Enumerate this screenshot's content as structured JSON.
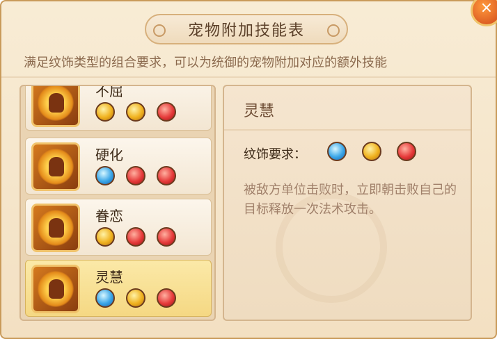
{
  "title": "宠物附加技能表",
  "close_icon": "×",
  "subtitle": "满足纹饰类型的组合要求，可以为统御的宠物附加对应的额外技能",
  "skills": [
    {
      "name": "不屈",
      "gems": [
        "gold",
        "gold",
        "red"
      ]
    },
    {
      "name": "硬化",
      "gems": [
        "blue",
        "red",
        "red"
      ]
    },
    {
      "name": "眷恋",
      "gems": [
        "gold",
        "red",
        "red"
      ]
    },
    {
      "name": "灵慧",
      "gems": [
        "blue",
        "gold",
        "red"
      ]
    }
  ],
  "detail": {
    "title": "灵慧",
    "req_label": "纹饰要求：",
    "gems": [
      "blue",
      "gold",
      "red"
    ],
    "description": "被敌方单位击败时，立即朝击败自己的目标释放一次法术攻击。"
  },
  "colors": {
    "gold": "#f0b21f",
    "red": "#e63b3b",
    "blue": "#3aa6e8",
    "selected": "#f5d883"
  }
}
